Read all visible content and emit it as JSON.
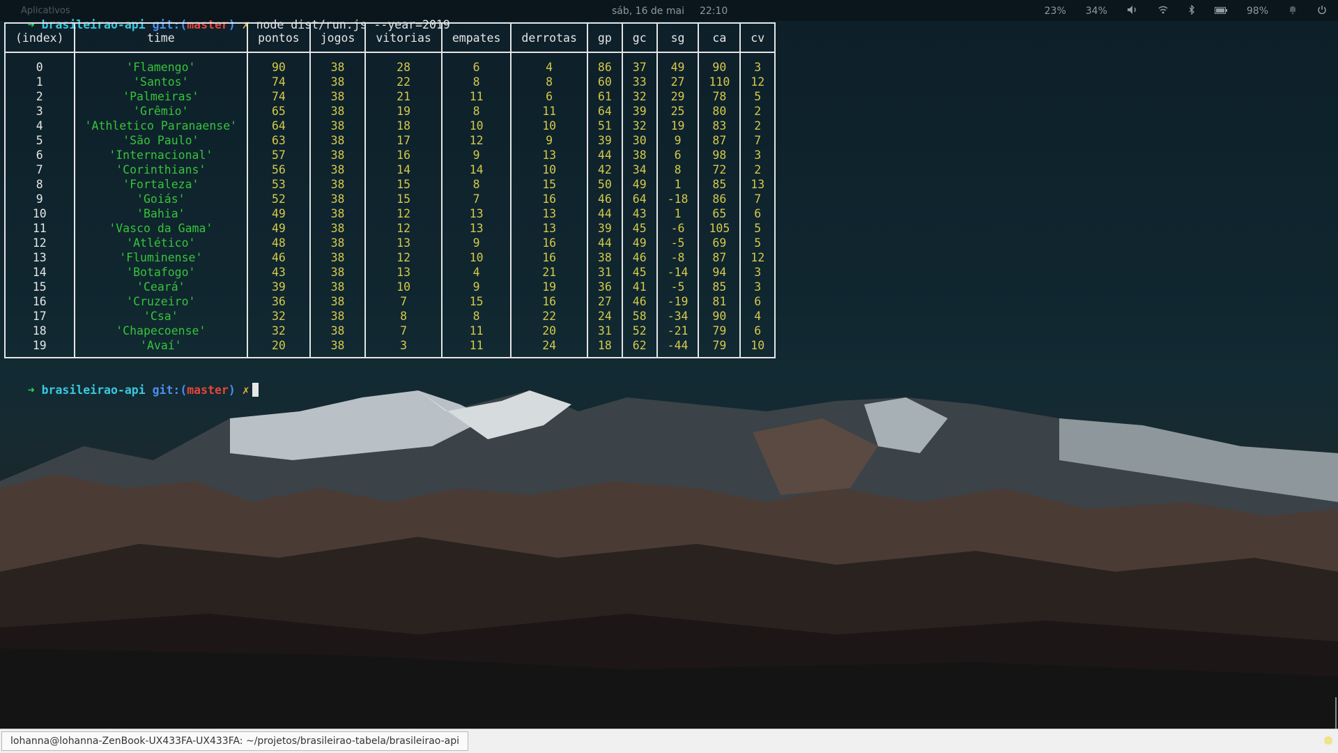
{
  "panel": {
    "apps_label": "Aplicativos",
    "date": "sáb, 16 de mai",
    "time": "22:10",
    "cpu": "23%",
    "mem": "34%",
    "battery": "98%"
  },
  "terminal": {
    "prompt": {
      "arrow": "➜",
      "dir": "brasileirao-api",
      "git_label": "git:(",
      "branch": "master",
      "git_close": ")",
      "dirty": "✗"
    },
    "command": "node dist/run.js --year=2019",
    "table": {
      "headers": [
        "(index)",
        "time",
        "pontos",
        "jogos",
        "vitorias",
        "empates",
        "derrotas",
        "gp",
        "gc",
        "sg",
        "ca",
        "cv"
      ],
      "rows": [
        [
          "0",
          "'Flamengo'",
          "90",
          "38",
          "28",
          "6",
          "4",
          "86",
          "37",
          "49",
          "90",
          "3"
        ],
        [
          "1",
          "'Santos'",
          "74",
          "38",
          "22",
          "8",
          "8",
          "60",
          "33",
          "27",
          "110",
          "12"
        ],
        [
          "2",
          "'Palmeiras'",
          "74",
          "38",
          "21",
          "11",
          "6",
          "61",
          "32",
          "29",
          "78",
          "5"
        ],
        [
          "3",
          "'Grêmio'",
          "65",
          "38",
          "19",
          "8",
          "11",
          "64",
          "39",
          "25",
          "80",
          "2"
        ],
        [
          "4",
          "'Athletico Paranaense'",
          "64",
          "38",
          "18",
          "10",
          "10",
          "51",
          "32",
          "19",
          "83",
          "2"
        ],
        [
          "5",
          "'São Paulo'",
          "63",
          "38",
          "17",
          "12",
          "9",
          "39",
          "30",
          "9",
          "87",
          "7"
        ],
        [
          "6",
          "'Internacional'",
          "57",
          "38",
          "16",
          "9",
          "13",
          "44",
          "38",
          "6",
          "98",
          "3"
        ],
        [
          "7",
          "'Corinthians'",
          "56",
          "38",
          "14",
          "14",
          "10",
          "42",
          "34",
          "8",
          "72",
          "2"
        ],
        [
          "8",
          "'Fortaleza'",
          "53",
          "38",
          "15",
          "8",
          "15",
          "50",
          "49",
          "1",
          "85",
          "13"
        ],
        [
          "9",
          "'Goiás'",
          "52",
          "38",
          "15",
          "7",
          "16",
          "46",
          "64",
          "-18",
          "86",
          "7"
        ],
        [
          "10",
          "'Bahia'",
          "49",
          "38",
          "12",
          "13",
          "13",
          "44",
          "43",
          "1",
          "65",
          "6"
        ],
        [
          "11",
          "'Vasco da Gama'",
          "49",
          "38",
          "12",
          "13",
          "13",
          "39",
          "45",
          "-6",
          "105",
          "5"
        ],
        [
          "12",
          "'Atlético'",
          "48",
          "38",
          "13",
          "9",
          "16",
          "44",
          "49",
          "-5",
          "69",
          "5"
        ],
        [
          "13",
          "'Fluminense'",
          "46",
          "38",
          "12",
          "10",
          "16",
          "38",
          "46",
          "-8",
          "87",
          "12"
        ],
        [
          "14",
          "'Botafogo'",
          "43",
          "38",
          "13",
          "4",
          "21",
          "31",
          "45",
          "-14",
          "94",
          "3"
        ],
        [
          "15",
          "'Ceará'",
          "39",
          "38",
          "10",
          "9",
          "19",
          "36",
          "41",
          "-5",
          "85",
          "3"
        ],
        [
          "16",
          "'Cruzeiro'",
          "36",
          "38",
          "7",
          "15",
          "16",
          "27",
          "46",
          "-19",
          "81",
          "6"
        ],
        [
          "17",
          "'Csa'",
          "32",
          "38",
          "8",
          "8",
          "22",
          "24",
          "58",
          "-34",
          "90",
          "4"
        ],
        [
          "18",
          "'Chapecoense'",
          "32",
          "38",
          "7",
          "11",
          "20",
          "31",
          "52",
          "-21",
          "79",
          "6"
        ],
        [
          "19",
          "'Avaí'",
          "20",
          "38",
          "3",
          "11",
          "24",
          "18",
          "62",
          "-44",
          "79",
          "10"
        ]
      ]
    }
  },
  "statusbar": {
    "window_title": "lohanna@lohanna-ZenBook-UX433FA-UX433FA: ~/projetos/brasileirao-tabela/brasileirao-api"
  },
  "colors": {
    "team_text": "#36c43a",
    "number_text": "#d4c94a",
    "prompt_arrow": "#2bd65a",
    "prompt_dir": "#39c8e0",
    "prompt_branch": "#e8443a"
  }
}
